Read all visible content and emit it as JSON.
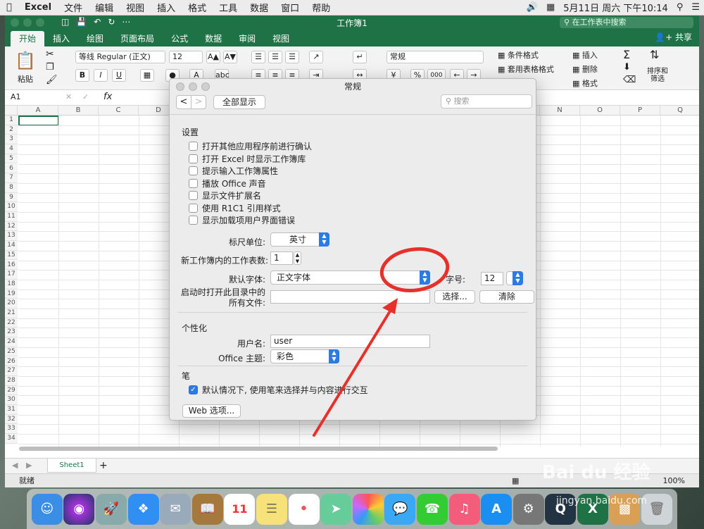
{
  "menubar": {
    "apple_icon": "apple-icon",
    "app": "Excel",
    "items": [
      "文件",
      "编辑",
      "视图",
      "插入",
      "格式",
      "工具",
      "数据",
      "窗口",
      "帮助"
    ],
    "datetime": "5月11日 周六 下午10:14"
  },
  "window": {
    "title": "工作簿1",
    "search_placeholder": "在工作表中搜索",
    "share": "共享",
    "tabs": [
      "开始",
      "插入",
      "绘图",
      "页面布局",
      "公式",
      "数据",
      "审阅",
      "视图"
    ],
    "active_tab": "开始",
    "accent": "#1f7246"
  },
  "ribbon": {
    "paste": "粘贴",
    "font_name": "等线 Regular (正文)",
    "font_size": "12",
    "bold": "B",
    "italic": "I",
    "underline": "U",
    "number_format": "常规",
    "cond_format": "条件格式",
    "table_format": "套用表格格式",
    "insert": "插入",
    "delete": "删除",
    "format": "格式",
    "sort_filter": "排序和\n筛选",
    "percent": "%",
    "thousands": "000"
  },
  "formula_bar": {
    "name_box": "A1",
    "fx": "fx"
  },
  "grid": {
    "columns": [
      "A",
      "B",
      "C",
      "D",
      "E",
      "F",
      "G",
      "H",
      "I",
      "J",
      "K",
      "L",
      "M",
      "N",
      "O",
      "P",
      "Q"
    ],
    "rows": [
      "1",
      "2",
      "3",
      "4",
      "5",
      "6",
      "7",
      "8",
      "9",
      "10",
      "11",
      "12",
      "13",
      "14",
      "15",
      "16",
      "17",
      "18",
      "19",
      "20",
      "21",
      "22",
      "23",
      "24",
      "25",
      "26",
      "27",
      "28",
      "29",
      "30",
      "31",
      "32",
      "33",
      "34"
    ]
  },
  "sheet": {
    "tab": "Sheet1",
    "add": "+"
  },
  "status": {
    "ready": "就绪",
    "zoom": "100%"
  },
  "dialog": {
    "title": "常规",
    "back": "<",
    "forward": ">",
    "show_all": "全部显示",
    "search_placeholder": "搜索",
    "settings_heading": "设置",
    "options": [
      {
        "label": "打开其他应用程序前进行确认",
        "checked": false
      },
      {
        "label": "打开 Excel 时显示工作簿库",
        "checked": false
      },
      {
        "label": "提示输入工作簿属性",
        "checked": false
      },
      {
        "label": "播放 Office 声音",
        "checked": false
      },
      {
        "label": "显示文件扩展名",
        "checked": false
      },
      {
        "label": "使用 R1C1 引用样式",
        "checked": false
      },
      {
        "label": "显示加载项用户界面错误",
        "checked": false
      }
    ],
    "ruler_label": "标尺单位:",
    "ruler_value": "英寸",
    "sheets_label": "新工作簿内的工作表数:",
    "sheets_value": "1",
    "font_label": "默认字体:",
    "font_value": "正文字体",
    "size_label": "字号:",
    "size_value": "12",
    "startup_label_1": "启动时打开此目录中的",
    "startup_label_2": "所有文件:",
    "startup_value": "",
    "choose": "选择...",
    "clear": "清除",
    "personal_heading": "个性化",
    "username_label": "用户名:",
    "username_value": "user",
    "theme_label": "Office 主题:",
    "theme_value": "彩色",
    "pen_heading": "笔",
    "pen_option": {
      "label": "默认情况下, 使用笔来选择并与内容进行交互",
      "checked": true
    },
    "web_options": "Web 选项..."
  },
  "annotation": {
    "color": "#e8302b"
  },
  "watermark": {
    "brand": "Bai du 经验",
    "url": "jingyan.baidu.com"
  }
}
